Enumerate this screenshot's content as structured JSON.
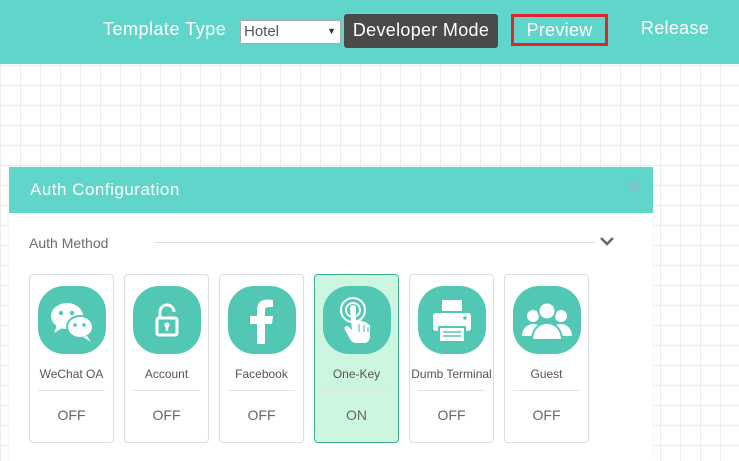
{
  "topbar": {
    "template_type_label": "Template Type",
    "template_type_value": "Hotel",
    "developer_mode_label": "Developer Mode",
    "preview_label": "Preview",
    "release_label": "Release"
  },
  "panel": {
    "title": "Auth Configuration",
    "close_glyph": "×",
    "section_label": "Auth Method",
    "methods": [
      {
        "label": "WeChat OA",
        "status": "OFF",
        "icon": "wechat-icon"
      },
      {
        "label": "Account",
        "status": "OFF",
        "icon": "lock-icon"
      },
      {
        "label": "Facebook",
        "status": "OFF",
        "icon": "facebook-icon"
      },
      {
        "label": "One-Key",
        "status": "ON",
        "icon": "tap-icon"
      },
      {
        "label": "Dumb Terminal",
        "status": "OFF",
        "icon": "printer-icon"
      },
      {
        "label": "Guest",
        "status": "OFF",
        "icon": "guest-group-icon"
      }
    ]
  },
  "colors": {
    "accent": "#5fd6c9",
    "icon_bg": "#52c8b4",
    "active_card_bg": "#cdf6e1",
    "active_card_border": "#3db18b",
    "highlight_border": "#e0252e",
    "dark_button": "#4a4a4a"
  }
}
